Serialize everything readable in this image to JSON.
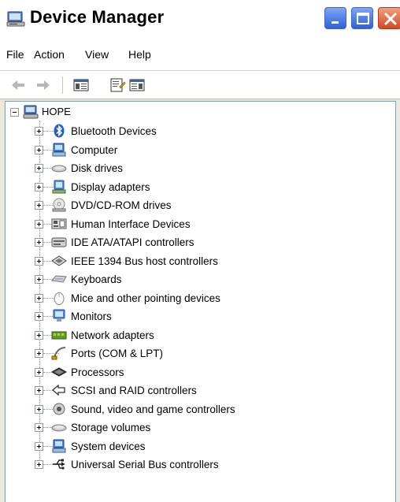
{
  "window": {
    "title": "Device Manager"
  },
  "menu": {
    "file": "File",
    "action": "Action",
    "view": "View",
    "help": "Help"
  },
  "toolbar": {
    "back_icon": "back-arrow-icon",
    "forward_icon": "forward-arrow-icon",
    "showhide_icon": "show-hide-console-tree-icon",
    "properties_icon": "properties-icon",
    "view_icon": "action-pane-icon"
  },
  "tree": {
    "root": "HOPE",
    "items": [
      {
        "label": "Bluetooth Devices",
        "icon": "bluetooth-icon"
      },
      {
        "label": "Computer",
        "icon": "computer-icon"
      },
      {
        "label": "Disk drives",
        "icon": "disk-drive-icon"
      },
      {
        "label": "Display adapters",
        "icon": "display-adapter-icon"
      },
      {
        "label": "DVD/CD-ROM drives",
        "icon": "cd-rom-icon"
      },
      {
        "label": "Human Interface Devices",
        "icon": "hid-icon"
      },
      {
        "label": "IDE ATA/ATAPI controllers",
        "icon": "ide-controller-icon"
      },
      {
        "label": "IEEE 1394 Bus host controllers",
        "icon": "ieee1394-icon"
      },
      {
        "label": "Keyboards",
        "icon": "keyboard-icon"
      },
      {
        "label": "Mice and other pointing devices",
        "icon": "mouse-icon"
      },
      {
        "label": "Monitors",
        "icon": "monitor-icon"
      },
      {
        "label": "Network adapters",
        "icon": "network-adapter-icon"
      },
      {
        "label": "Ports (COM & LPT)",
        "icon": "port-icon"
      },
      {
        "label": "Processors",
        "icon": "processor-icon"
      },
      {
        "label": "SCSI and RAID controllers",
        "icon": "scsi-icon"
      },
      {
        "label": "Sound, video and game controllers",
        "icon": "sound-icon"
      },
      {
        "label": "Storage volumes",
        "icon": "storage-volume-icon"
      },
      {
        "label": "System devices",
        "icon": "system-device-icon"
      },
      {
        "label": "Universal Serial Bus controllers",
        "icon": "usb-icon"
      }
    ]
  }
}
